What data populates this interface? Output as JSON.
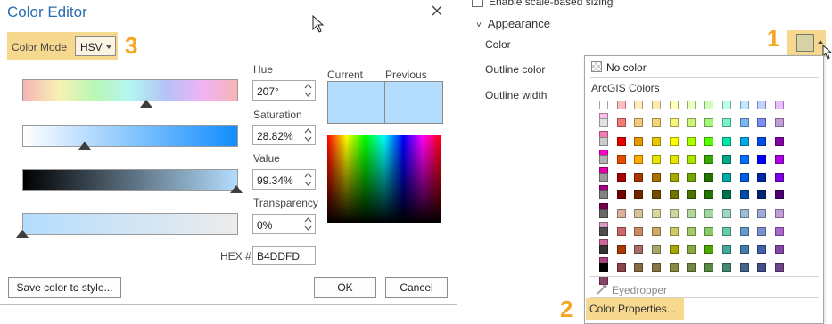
{
  "dialog": {
    "title": "Color Editor",
    "color_mode_label": "Color Mode",
    "color_mode_value": "HSV",
    "callout": "3",
    "hue": {
      "label": "Hue",
      "value": "207°",
      "fraction": 0.575
    },
    "saturation": {
      "label": "Saturation",
      "value": "28.82%",
      "fraction": 0.2882
    },
    "brightness": {
      "label": "Value",
      "value": "99.34%",
      "fraction": 0.9934
    },
    "transparency": {
      "label": "Transparency",
      "value": "0%",
      "fraction": 0.0
    },
    "hex_label": "HEX #",
    "hex_value": "B4DDFD",
    "current_label": "Current",
    "previous_label": "Previous",
    "current_color": "#B4DDFD",
    "previous_color": "#B4DDFD",
    "buttons": {
      "save": "Save color to style...",
      "ok": "OK",
      "cancel": "Cancel"
    }
  },
  "panel": {
    "scale_checkbox_label": "Enable scale-based sizing",
    "section_title": "Appearance",
    "color_label": "Color",
    "outline_color_label": "Outline color",
    "outline_width_label": "Outline width",
    "color_swatch": "#D6D2A6",
    "callout_1": "1",
    "callout_2": "2"
  },
  "palette": {
    "no_color": "No color",
    "title": "ArcGIS Colors",
    "eyedropper": "Eyedropper",
    "color_properties": "Color Properties...",
    "rows": [
      [
        "#ffffff",
        "#ffbebe",
        "#ffebbe",
        "#ffebaf",
        "#ffffbe",
        "#e9ffbe",
        "#d3ffbe",
        "#beffe8",
        "#bee8ff",
        "#bed2ff",
        "#e8beff",
        "#ffbee8"
      ],
      [
        "#e1e1e1",
        "#f57a7a",
        "#f5ca7a",
        "#f5d57a",
        "#f5f57a",
        "#cdf57a",
        "#a5f57a",
        "#7af5ca",
        "#7ab6f5",
        "#7a8ef5",
        "#c29ed7",
        "#f57ab6"
      ],
      [
        "#cccccc",
        "#e60000",
        "#e69800",
        "#e6c700",
        "#ffff00",
        "#aaff00",
        "#55ff00",
        "#00e6a9",
        "#00a9e6",
        "#004ce6",
        "#8400a8",
        "#ff00c5"
      ],
      [
        "#b2b2b2",
        "#e64c00",
        "#ffaa00",
        "#e6e600",
        "#e6e600",
        "#a8e600",
        "#38a800",
        "#00a884",
        "#0070ff",
        "#0000ff",
        "#a900e6",
        "#e600a9"
      ],
      [
        "#9c9c9c",
        "#a80000",
        "#a83800",
        "#a87000",
        "#a8a800",
        "#70a800",
        "#267300",
        "#00a8a8",
        "#005ce6",
        "#0026a8",
        "#7a00e6",
        "#a80084"
      ],
      [
        "#828282",
        "#730000",
        "#732600",
        "#734c00",
        "#737300",
        "#4c7300",
        "#267300",
        "#00734c",
        "#004da8",
        "#002673",
        "#4c0073",
        "#73004c"
      ],
      [
        "#686868",
        "#d7b09e",
        "#d7c29e",
        "#d7d79e",
        "#d1d7a0",
        "#b4d79e",
        "#a3d7a0",
        "#9ed7c2",
        "#9ebbd7",
        "#9eaad7",
        "#c29ed7",
        "#d79ec2"
      ],
      [
        "#4e4e4e",
        "#cd6666",
        "#cd8966",
        "#cdaa66",
        "#cdcd66",
        "#a3cc66",
        "#89cd66",
        "#66cdab",
        "#6699cd",
        "#7c8fcd",
        "#aa66cd",
        "#cd6699"
      ],
      [
        "#343434",
        "#a83800",
        "#a86b6b",
        "#a8a86b",
        "#a8a800",
        "#89a844",
        "#4ca800",
        "#44a89c",
        "#447ba8",
        "#445fa8",
        "#8444a8",
        "#a8447b"
      ],
      [
        "#000000",
        "#894444",
        "#896844",
        "#897544",
        "#898944",
        "#728944",
        "#558944",
        "#448970",
        "#446589",
        "#444f89",
        "#704489",
        "#894465"
      ]
    ]
  }
}
